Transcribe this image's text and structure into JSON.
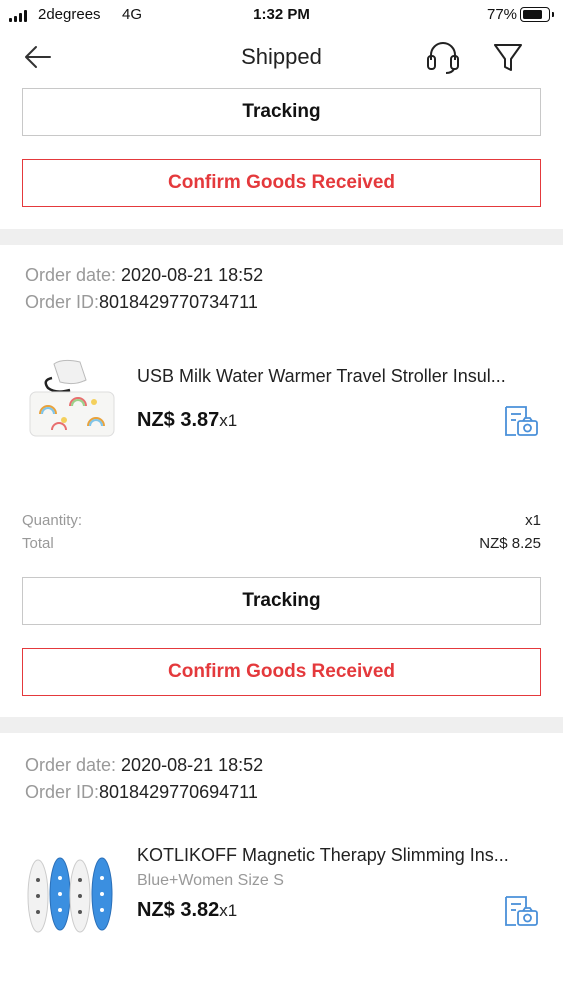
{
  "status_bar": {
    "carrier": "2degrees",
    "network": "4G",
    "time": "1:32 PM",
    "battery": "77%"
  },
  "header": {
    "title": "Shipped",
    "back_icon": "arrow-left-icon",
    "support_icon": "headset-icon",
    "filter_icon": "funnel-icon"
  },
  "top_actions": {
    "tracking": "Tracking",
    "confirm": "Confirm Goods Received"
  },
  "orders": [
    {
      "date_label": "Order date: ",
      "date": "2020-08-21 18:52",
      "id_label": "Order ID:",
      "id": "8018429770734711",
      "product": {
        "title": "USB Milk Water Warmer Travel Stroller Insul...",
        "variant": "",
        "price": "NZ$ 3.87",
        "qty": "x1"
      },
      "quantity_label": "Quantity:",
      "quantity": "x1",
      "total_label": "Total",
      "total": "NZ$ 8.25",
      "tracking": "Tracking",
      "confirm": "Confirm Goods Received"
    },
    {
      "date_label": "Order date: ",
      "date": "2020-08-21 18:52",
      "id_label": "Order ID:",
      "id": "8018429770694711",
      "product": {
        "title": "KOTLIKOFF Magnetic Therapy Slimming Ins...",
        "variant": "Blue+Women Size S",
        "price": "NZ$ 3.82",
        "qty": "x1",
        "brand_mark": "KOTLIKOFF"
      }
    }
  ],
  "colors": {
    "accent": "#e4393c",
    "review_icon": "#4a90d9",
    "divider": "#efefef"
  }
}
